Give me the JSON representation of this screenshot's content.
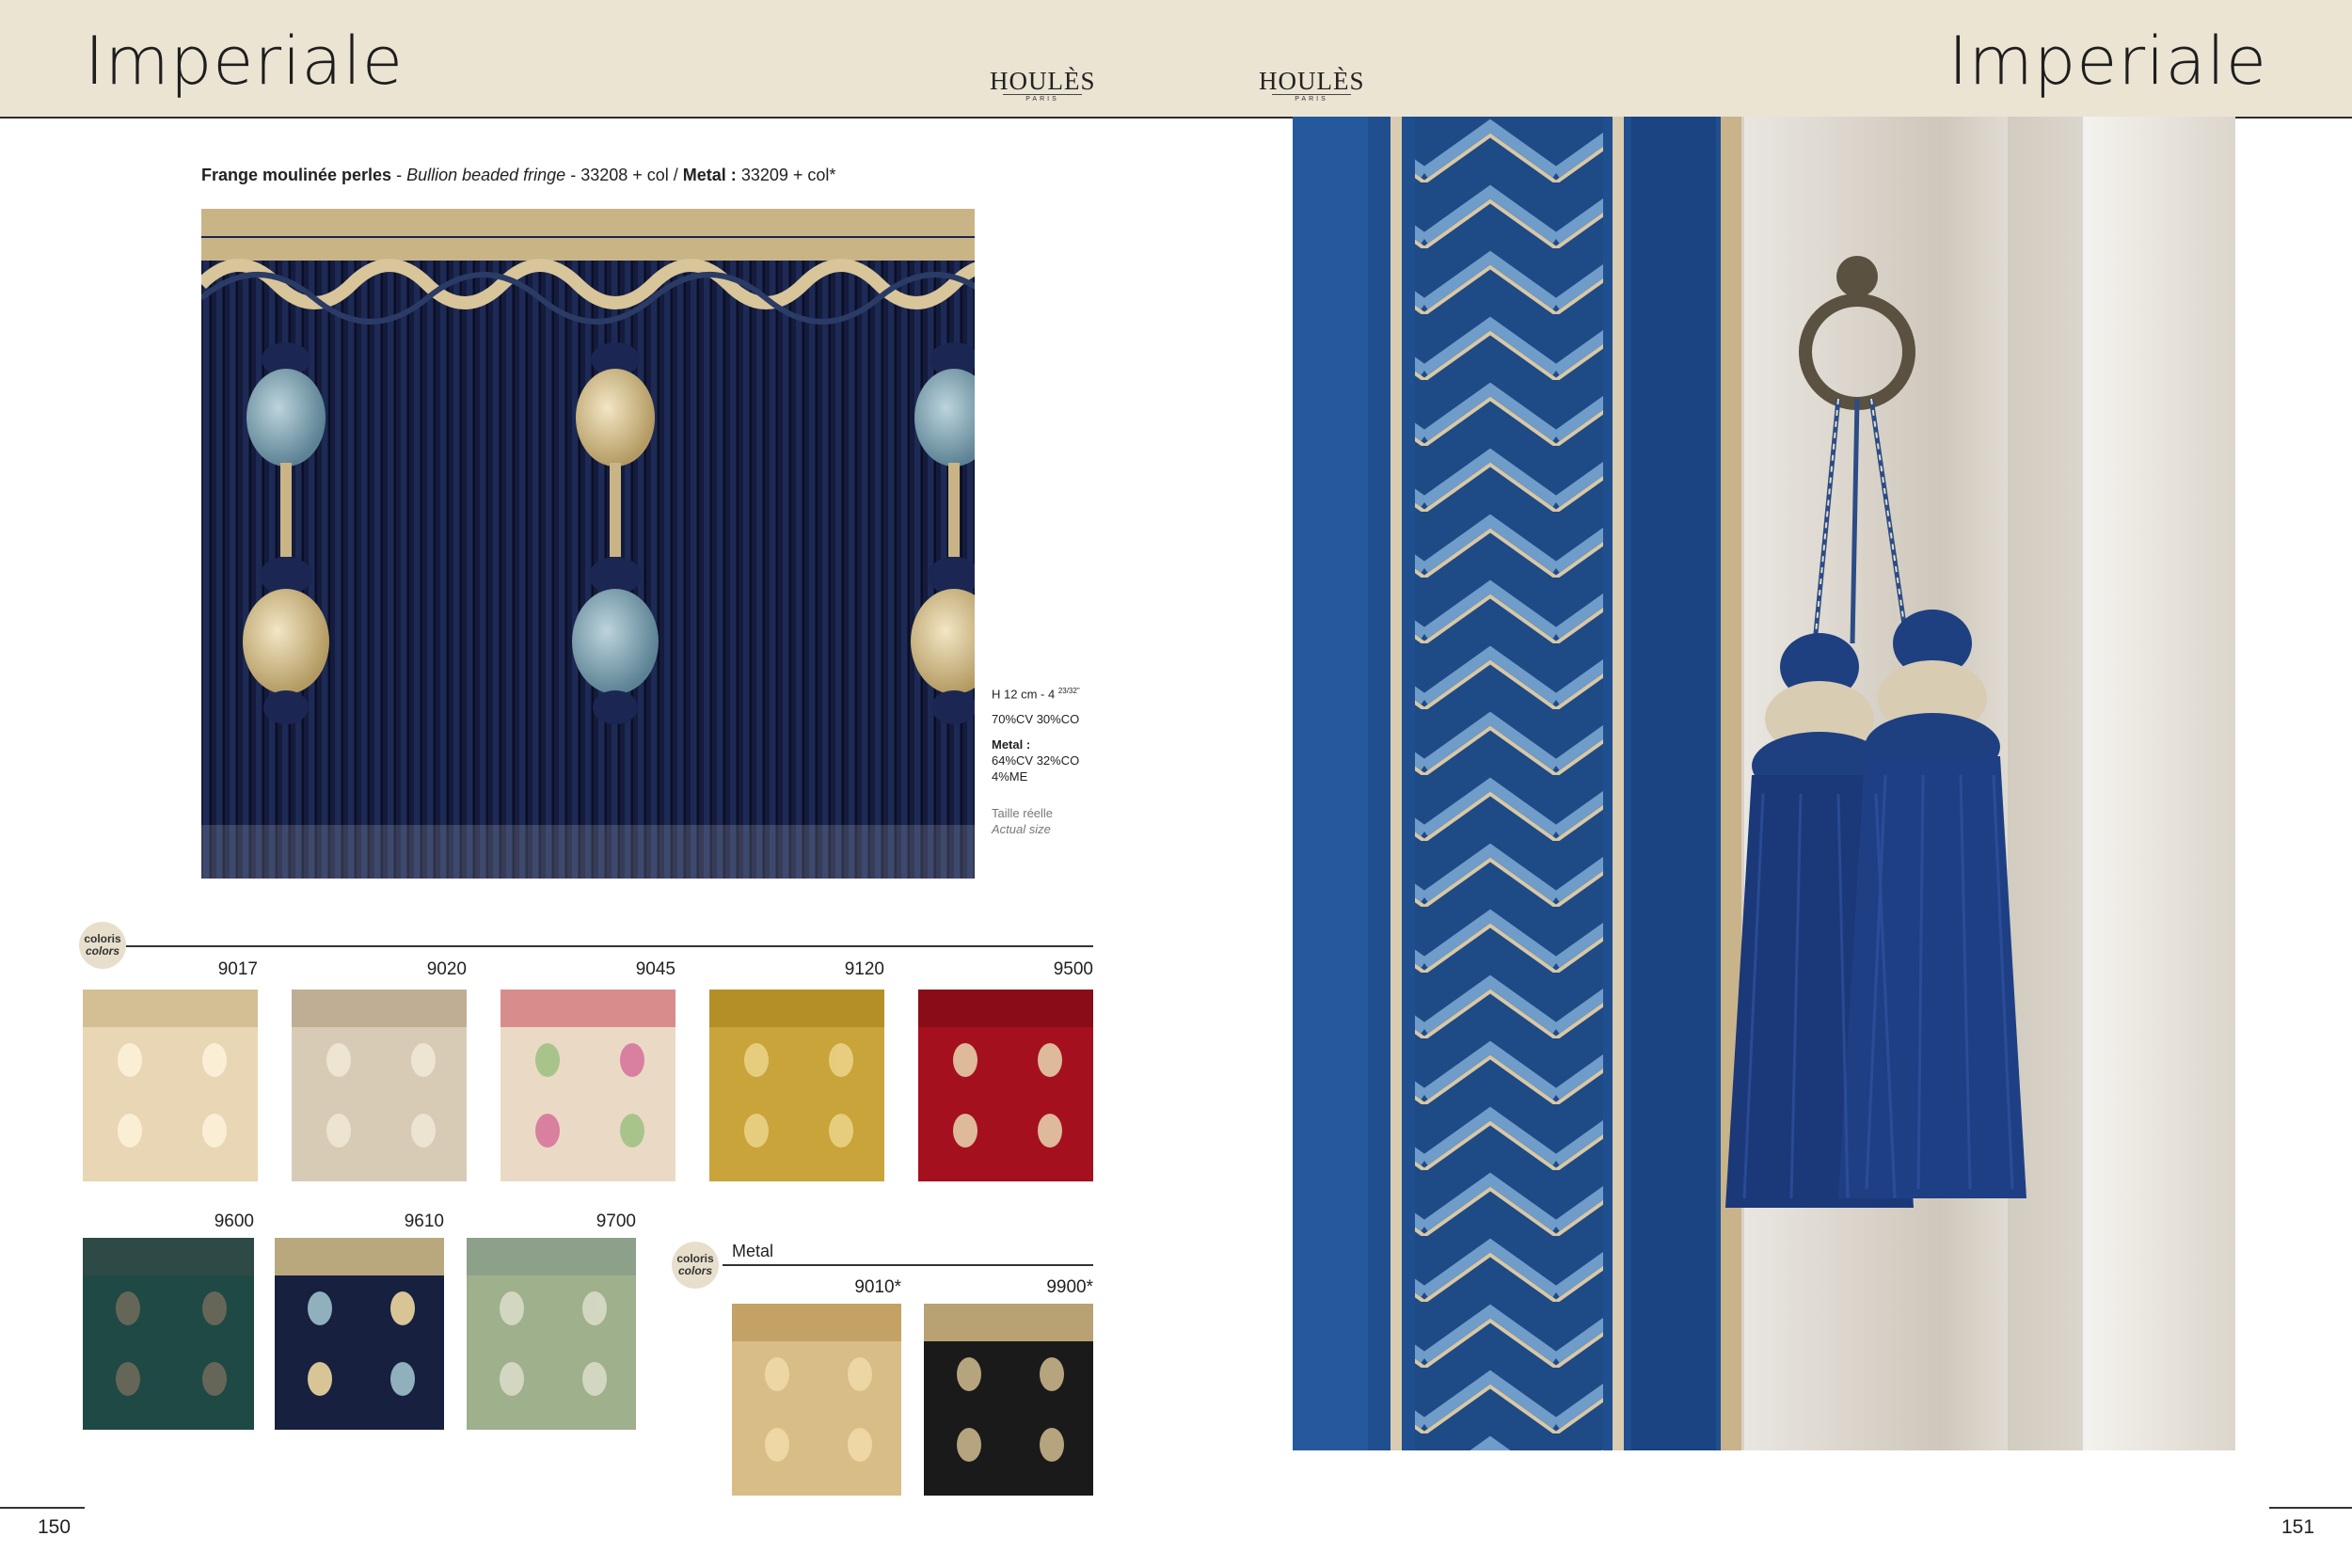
{
  "header": {
    "title_left": "Imperiale",
    "title_right": "Imperiale",
    "brand_left": "HOULÈS",
    "brand_left_sub": "PARIS",
    "brand_right": "HOULÈS",
    "brand_right_sub": "PARIS"
  },
  "product": {
    "name_fr": "Frange moulinée perles",
    "sep1": " - ",
    "name_en": "Bullion beaded fringe",
    "sep2": " - ",
    "ref": "33208 + col",
    "sep3": " / ",
    "metal_label": "Metal :",
    "metal_ref": " 33209 + col*"
  },
  "specs": {
    "height": "H 12 cm - 4",
    "height_frac": "23/32\"",
    "composition": "70%CV 30%CO",
    "metal_label": "Metal :",
    "metal_comp_1": "64%CV 32%CO",
    "metal_comp_2": "4%ME",
    "size_fr": "Taille réelle",
    "size_en": "Actual size"
  },
  "colors_section": {
    "badge_fr": "coloris",
    "badge_en": "colors",
    "swatches_row1": [
      {
        "code": "9017",
        "color": "#e8d6b5"
      },
      {
        "code": "9020",
        "color": "#d8cbb6"
      },
      {
        "code": "9045",
        "color": "#eadac5"
      },
      {
        "code": "9120",
        "color": "#c9a43a"
      },
      {
        "code": "9500",
        "color": "#a5101f"
      }
    ],
    "swatches_row2": [
      {
        "code": "9600",
        "color": "#1f4944"
      },
      {
        "code": "9610",
        "color": "#17203f"
      },
      {
        "code": "9700",
        "color": "#9fb08c"
      }
    ]
  },
  "metal_section": {
    "badge_fr": "coloris",
    "badge_en": "colors",
    "label": "Metal",
    "swatches": [
      {
        "code": "9010*",
        "color": "#d9bd86"
      },
      {
        "code": "9900*",
        "color": "#1a1a1a"
      }
    ]
  },
  "footer": {
    "page_left": "150",
    "page_right": "151"
  }
}
